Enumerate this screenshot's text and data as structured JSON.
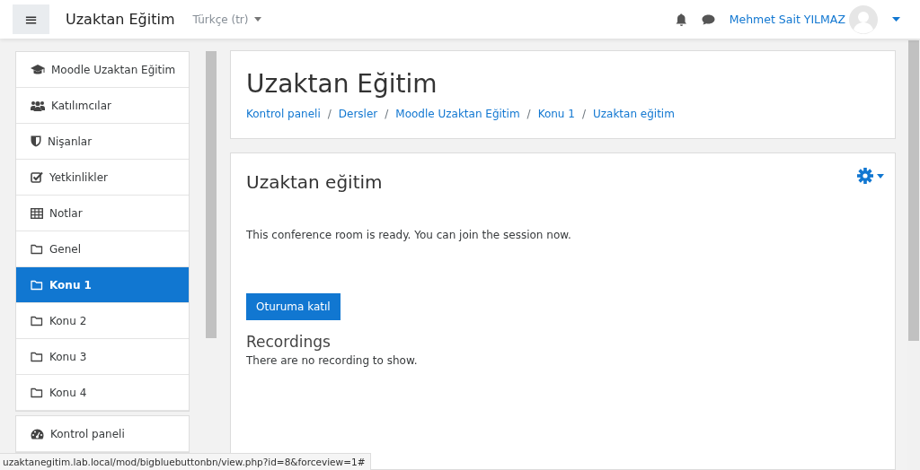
{
  "navbar": {
    "menu_button": "≡",
    "site_name": "Uzaktan Eğitim",
    "language": "Türkçe (tr)",
    "user_name": "Mehmet Sait YILMAZ"
  },
  "sidebar": {
    "groups": [
      {
        "items": [
          {
            "label": "Moodle Uzaktan Eğitim",
            "kind": "course",
            "selected": false
          },
          {
            "label": "Katılımcılar",
            "kind": "participants",
            "selected": false
          },
          {
            "label": "Nişanlar",
            "kind": "badges",
            "selected": false
          },
          {
            "label": "Yetkinlikler",
            "kind": "competencies",
            "selected": false
          },
          {
            "label": "Notlar",
            "kind": "grades",
            "selected": false
          },
          {
            "label": "Genel",
            "kind": "section",
            "selected": false
          },
          {
            "label": "Konu 1",
            "kind": "section",
            "selected": true
          },
          {
            "label": "Konu 2",
            "kind": "section",
            "selected": false
          },
          {
            "label": "Konu 3",
            "kind": "section",
            "selected": false
          },
          {
            "label": "Konu 4",
            "kind": "section",
            "selected": false
          }
        ]
      },
      {
        "items": [
          {
            "label": "Kontrol paneli",
            "kind": "dashboard",
            "selected": false
          }
        ]
      }
    ]
  },
  "header": {
    "title": "Uzaktan Eğitim",
    "breadcrumb_separator": "/",
    "breadcrumb": [
      "Kontrol paneli",
      "Dersler",
      "Moodle Uzaktan Eğitim",
      "Konu 1",
      "Uzaktan eğitim"
    ]
  },
  "activity": {
    "title": "Uzaktan eğitim",
    "message": "This conference room is ready. You can join the session now.",
    "join_button": "Oturuma katıl",
    "recordings_title": "Recordings",
    "recordings_message": "There are no recording to show."
  },
  "status_bar": {
    "url": "uzaktanegitim.lab.local/mod/bigbluebuttonbn/view.php?id=8&forceview=1#"
  }
}
